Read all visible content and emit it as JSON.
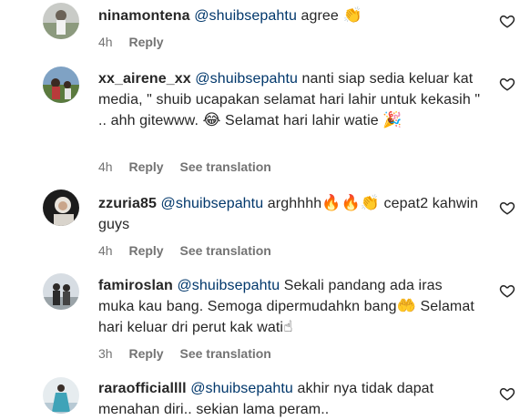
{
  "comments": [
    {
      "username": "ninamontena",
      "mention": "@shuibsepahtu",
      "text": " agree ",
      "emoji": "👏",
      "time": "4h",
      "reply": "Reply",
      "translate": ""
    },
    {
      "username": "xx_airene_xx",
      "mention": "@shuibsepahtu",
      "text": " nanti siap sedia keluar kat media, \" shuib ucapakan selamat hari lahir untuk kekasih \" .. ahh gitewww. ",
      "emoji": "😂",
      "text2": " Selamat hari lahir watie ",
      "emoji2": "🎉",
      "time": "4h",
      "reply": "Reply",
      "translate": "See translation"
    },
    {
      "username": "zzuria85",
      "mention": "@shuibsepahtu",
      "text": " arghhhh",
      "emoji": "🔥🔥👏",
      "text2": " cepat2 kahwin guys",
      "time": "4h",
      "reply": "Reply",
      "translate": "See translation"
    },
    {
      "username": "famiroslan",
      "mention": "@shuibsepahtu",
      "text": " Sekali pandang ada iras muka kau bang. Semoga dipermudahkn bang",
      "emoji": "🤲",
      "text2": " Selamat hari keluar dri perut kak wati",
      "emoji2": "☝",
      "time": "3h",
      "reply": "Reply",
      "translate": "See translation"
    },
    {
      "username": "raraofficiallll",
      "mention": "@shuibsepahtu",
      "text": " akhir nya tidak dapat menahan diri.. sekian lama peram..",
      "time": "",
      "reply": "",
      "translate": ""
    }
  ],
  "icons": {
    "like": "heart-outline-icon"
  },
  "colors": {
    "mention": "#00376b",
    "meta": "#737373",
    "text": "#262626"
  }
}
